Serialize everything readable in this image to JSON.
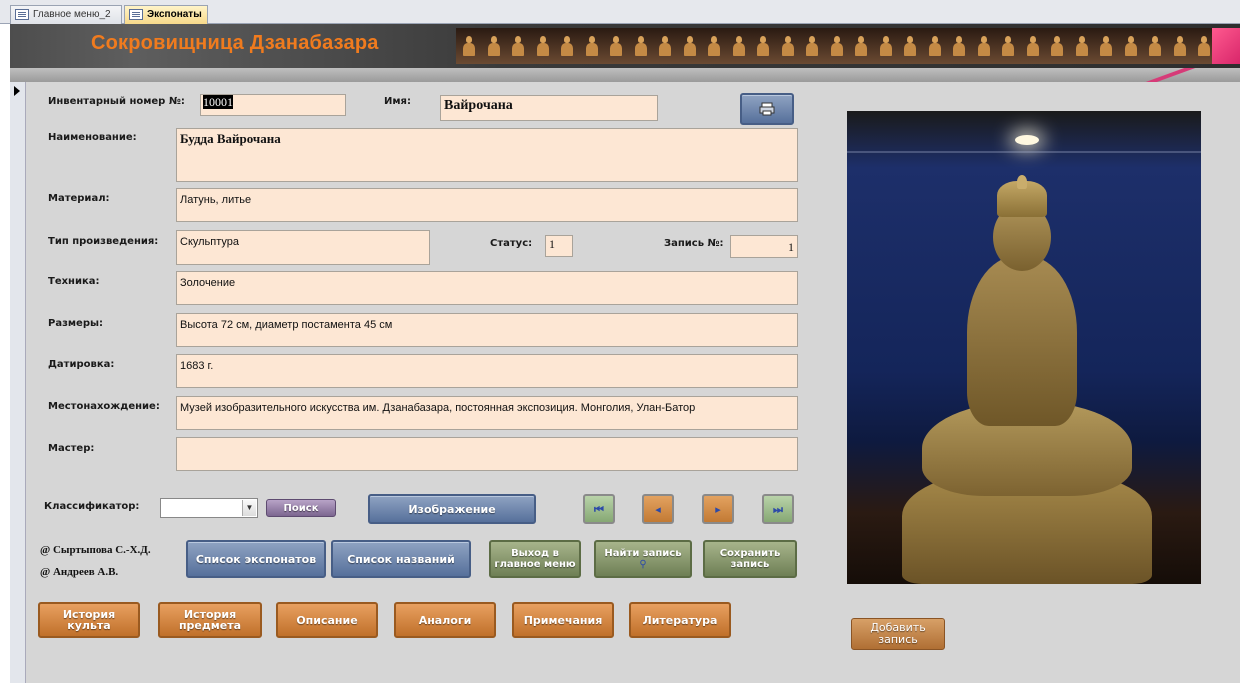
{
  "tabs": [
    {
      "label": "Главное меню_2"
    },
    {
      "label": "Экспонаты"
    }
  ],
  "header": {
    "title": "Сокровищница Дзанабазара"
  },
  "form": {
    "inventory_label": "Инвентарный номер №:",
    "inventory_value": "10001",
    "name_label": "Имя:",
    "name_value": "Вайрочана",
    "title_label": "Наименование:",
    "title_value": "Будда Вайрочана",
    "material_label": "Материал:",
    "material_value": "Латунь, литье",
    "type_label": "Тип произведения:",
    "type_value": "Скульптура",
    "status_label": "Статус:",
    "status_value": "1",
    "record_label": "Запись №:",
    "record_value": "1",
    "technique_label": "Техника:",
    "technique_value": "Золочение",
    "size_label": "Размеры:",
    "size_value": "Высота 72 см, диаметр постамента 45 см",
    "date_label": "Датировка:",
    "date_value": "1683 г.",
    "location_label": "Местонахождение:",
    "location_value": "Музей изобразительного искусства им. Дзанабазара, постоянная экспозиция. Монголия, Улан-Батор",
    "master_label": "Мастер:",
    "master_value": "",
    "classifier_label": "Классификатор:",
    "classifier_value": ""
  },
  "buttons": {
    "search": "Поиск",
    "image": "Изображение",
    "list_exhibits": "Список экспонатов",
    "list_names": "Список названий",
    "exit_main": "Выход в главное меню",
    "find_record": "Найти запись",
    "save_record": "Сохранить запись",
    "history_cult": "История культа",
    "history_item": "История предмета",
    "description": "Описание",
    "analogs": "Аналоги",
    "notes": "Примечания",
    "literature": "Литература",
    "add_record": "Добавить запись"
  },
  "authors": [
    "@ Сыртыпова С.-Х.Д.",
    "@ Андреев А.В."
  ],
  "icons": {
    "printer": "printer-icon",
    "first": "first-record-icon",
    "prev": "prev-record-icon",
    "next": "next-record-icon",
    "last": "last-record-icon",
    "binoculars": "binoculars-icon"
  },
  "colors": {
    "accent": "#f07b1e",
    "field_bg": "#fde7d4",
    "body_bg": "#d6d6d6"
  }
}
